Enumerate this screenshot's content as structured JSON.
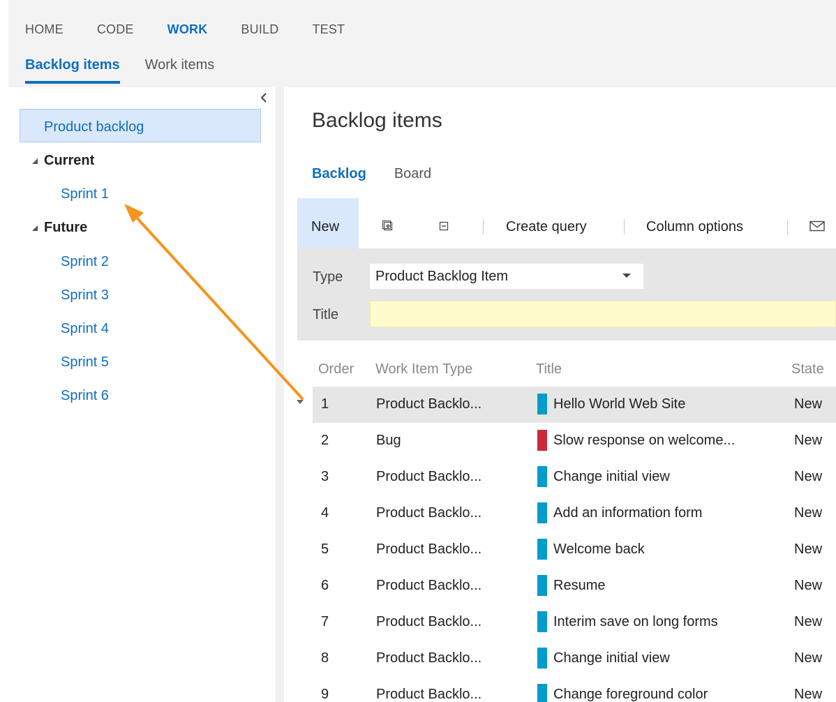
{
  "colors": {
    "accent": "#106ebe",
    "pbi": "#009ccc",
    "bug": "#cc293d",
    "arrow": "#f7941d"
  },
  "main_nav": [
    {
      "label": "HOME",
      "active": false
    },
    {
      "label": "CODE",
      "active": false
    },
    {
      "label": "WORK",
      "active": true
    },
    {
      "label": "BUILD",
      "active": false
    },
    {
      "label": "TEST",
      "active": false
    }
  ],
  "sub_nav": [
    {
      "label": "Backlog items",
      "active": true
    },
    {
      "label": "Work items",
      "active": false
    }
  ],
  "sidebar": {
    "selected": "Product backlog",
    "groups": [
      {
        "label": "Current",
        "items": [
          "Sprint 1"
        ]
      },
      {
        "label": "Future",
        "items": [
          "Sprint 2",
          "Sprint 3",
          "Sprint 4",
          "Sprint 5",
          "Sprint 6"
        ]
      }
    ]
  },
  "main": {
    "title": "Backlog items",
    "tabs": [
      {
        "label": "Backlog",
        "active": true
      },
      {
        "label": "Board",
        "active": false
      }
    ],
    "toolbar": {
      "new_label": "New",
      "expand_icon": "expand-all-icon",
      "collapse_icon": "collapse-all-icon",
      "create_query": "Create query",
      "column_options": "Column options",
      "email_icon": "email-icon"
    },
    "quick_add": {
      "type_label": "Type",
      "type_value": "Product Backlog Item",
      "title_label": "Title",
      "title_value": ""
    },
    "columns": [
      "Order",
      "Work Item Type",
      "Title",
      "State"
    ],
    "rows": [
      {
        "order": "1",
        "type": "Product Backlo...",
        "title": "Hello World Web Site",
        "state": "New",
        "kind": "pbi"
      },
      {
        "order": "2",
        "type": "Bug",
        "title": "Slow response on welcome...",
        "state": "New",
        "kind": "bug"
      },
      {
        "order": "3",
        "type": "Product Backlo...",
        "title": "Change initial view",
        "state": "New",
        "kind": "pbi"
      },
      {
        "order": "4",
        "type": "Product Backlo...",
        "title": "Add an information form",
        "state": "New",
        "kind": "pbi"
      },
      {
        "order": "5",
        "type": "Product Backlo...",
        "title": "Welcome back",
        "state": "New",
        "kind": "pbi"
      },
      {
        "order": "6",
        "type": "Product Backlo...",
        "title": "Resume",
        "state": "New",
        "kind": "pbi"
      },
      {
        "order": "7",
        "type": "Product Backlo...",
        "title": "Interim save on long forms",
        "state": "New",
        "kind": "pbi"
      },
      {
        "order": "8",
        "type": "Product Backlo...",
        "title": "Change initial view",
        "state": "New",
        "kind": "pbi"
      },
      {
        "order": "9",
        "type": "Product Backlo...",
        "title": "Change foreground color",
        "state": "New",
        "kind": "pbi"
      }
    ]
  }
}
